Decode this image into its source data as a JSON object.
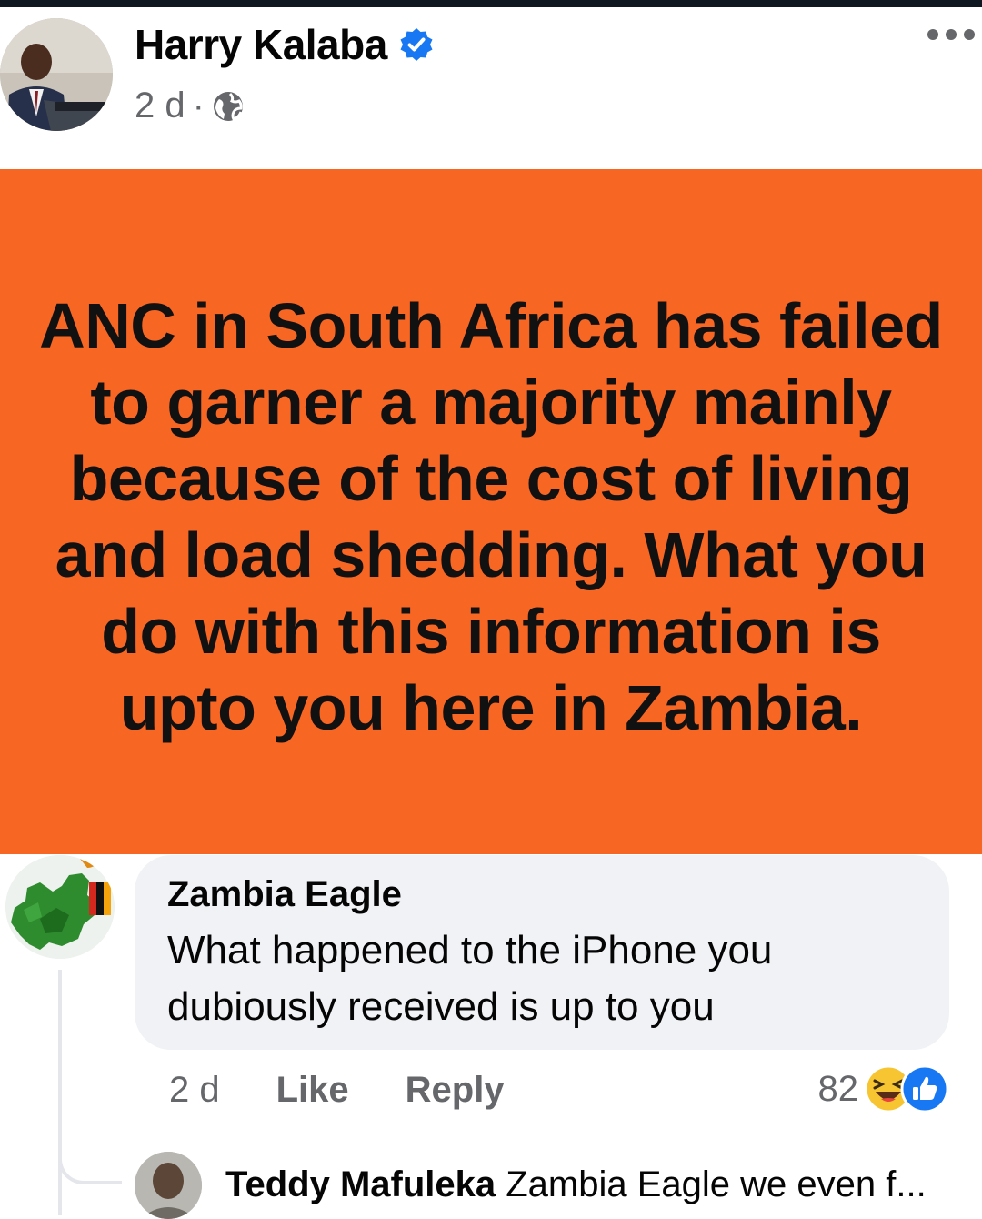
{
  "post": {
    "author": "Harry Kalaba",
    "time": "2 d",
    "separator": "·",
    "text": "ANC in South Africa has failed to garner  a majority mainly because of the cost of living and load shedding. What you do with this information is upto you here in Zambia.",
    "background_color": "#f86624"
  },
  "comment": {
    "author": "Zambia Eagle",
    "text": "What happened to the iPhone you dubiously received is up to you",
    "time": "2 d",
    "like_label": "Like",
    "reply_label": "Reply",
    "reaction_count": "82",
    "reaction_icons": [
      "laughing-face-icon",
      "thumbs-up-icon"
    ]
  },
  "reply": {
    "author": "Teddy Mafuleka",
    "text": "Zambia Eagle we even f..."
  },
  "icons": {
    "verified": "verified-badge-icon",
    "audience": "globe-icon",
    "more": "more-options-icon"
  },
  "colors": {
    "accent": "#1877f2",
    "meta_text": "#65676b",
    "bubble_bg": "#f0f2f5"
  }
}
